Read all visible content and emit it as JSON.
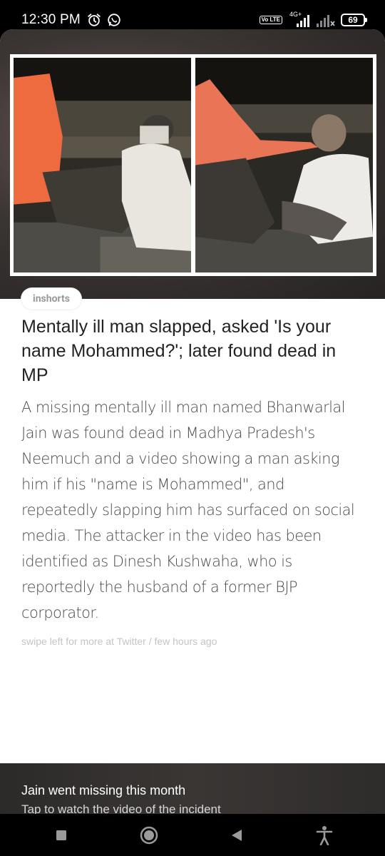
{
  "status_bar": {
    "time": "12:30 PM",
    "left_icons": [
      "alarm-icon",
      "whatsapp-icon"
    ],
    "network_label": "4G+",
    "volte_label": "Vo LTE",
    "battery": "69"
  },
  "article": {
    "source": "inshorts",
    "headline": "Mentally ill man slapped, asked 'Is your name Mohammed?'; later found dead in MP",
    "body": "A missing mentally ill man named Bhanwarlal Jain was found dead in Madhya Pradesh's Neemuch and a video showing a man asking him if his \"name is Mohammed\", and repeatedly slapping him has surfaced on social media. The attacker in the video has been identified as Dinesh Kushwaha, who is reportedly the husband of a former BJP corporator.",
    "meta": "swipe left for more at Twitter / few hours ago"
  },
  "footer": {
    "title": "Jain went missing this month",
    "subtitle": "Tap to watch the video of the incident"
  },
  "nav_bar": {
    "buttons": [
      "recents-square-icon",
      "home-circle-icon",
      "back-triangle-icon",
      "accessibility-icon"
    ]
  }
}
